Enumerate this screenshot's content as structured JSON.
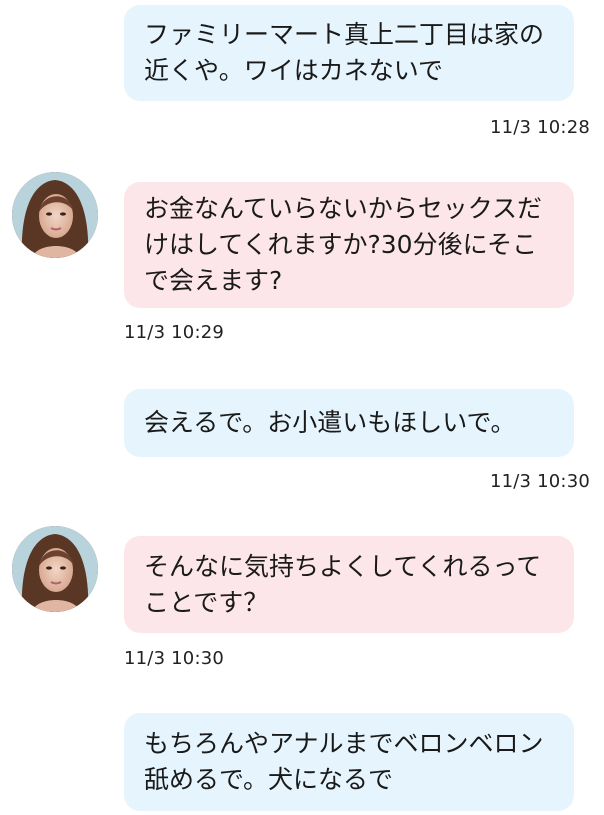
{
  "messages": [
    {
      "side": "sent",
      "text": "ファミリーマート真上二丁目は家の近くや。ワイはカネないで",
      "time": "11/3 10:28"
    },
    {
      "side": "received",
      "text": "お金なんていらないからセックスだけはしてくれますか?30分後にそこで会えます?",
      "time": "11/3 10:29",
      "avatar": "user-avatar-photo"
    },
    {
      "side": "sent",
      "text": "会えるで。お小遣いもほしいで。",
      "time": "11/3 10:30"
    },
    {
      "side": "received",
      "text": "そんなに気持ちよくしてくれるってことです？",
      "time": "11/3 10:30",
      "avatar": "user-avatar-photo"
    },
    {
      "side": "sent",
      "text": "もちろんやアナルまでベロンベロン舐めるで。犬になるで",
      "time": ""
    }
  ],
  "colors": {
    "sent_bubble": "#e6f5fd",
    "received_bubble": "#fde6ea",
    "text": "#1a1a1a"
  }
}
